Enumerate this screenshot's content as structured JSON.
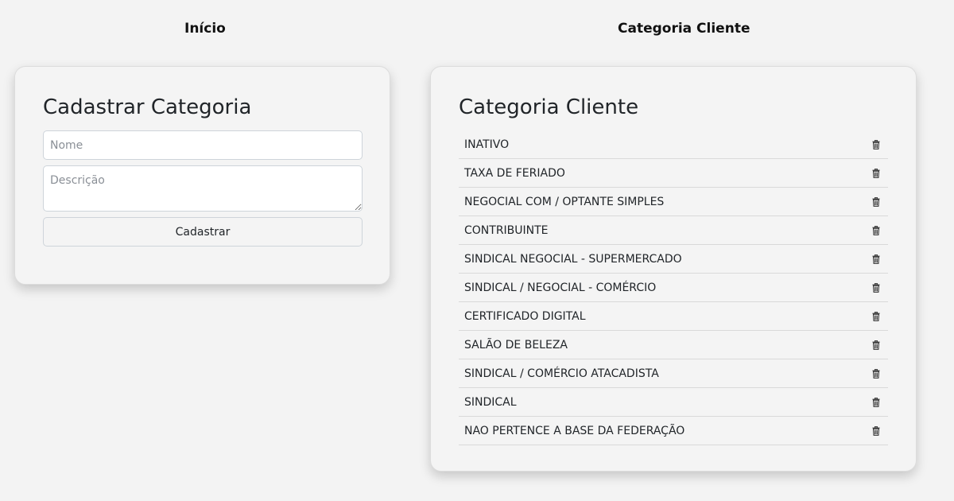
{
  "nav": {
    "home_label": "Início",
    "category_label": "Categoria Cliente"
  },
  "form": {
    "title": "Cadastrar Categoria",
    "name_placeholder": "Nome",
    "name_value": "",
    "description_placeholder": "Descrição",
    "description_value": "",
    "submit_label": "Cadastrar"
  },
  "list": {
    "title": "Categoria Cliente",
    "delete_icon": "trash-icon",
    "items": [
      {
        "label": "INATIVO"
      },
      {
        "label": "TAXA DE FERIADO"
      },
      {
        "label": "NEGOCIAL COM / OPTANTE SIMPLES"
      },
      {
        "label": "CONTRIBUINTE"
      },
      {
        "label": "SINDICAL NEGOCIAL - SUPERMERCADO"
      },
      {
        "label": "SINDICAL / NEGOCIAL - COMÉRCIO"
      },
      {
        "label": "CERTIFICADO DIGITAL"
      },
      {
        "label": "SALÃO DE BELEZA"
      },
      {
        "label": "SINDICAL / COMÉRCIO ATACADISTA"
      },
      {
        "label": "SINDICAL"
      },
      {
        "label": "NAO PERTENCE A BASE DA FEDERAÇÃO"
      }
    ]
  }
}
